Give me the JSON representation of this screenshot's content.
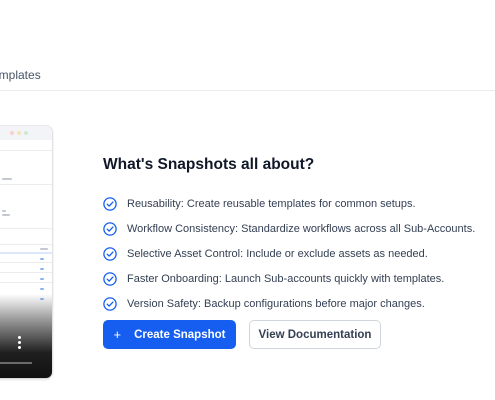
{
  "tabs": {
    "templates_label": "emplates"
  },
  "main": {
    "title": "What's Snapshots all about?",
    "features": [
      "Reusability: Create reusable templates for common setups.",
      "Workflow Consistency: Standardize workflows across all Sub-Accounts.",
      "Selective Asset Control: Include or exclude assets as needed.",
      "Faster Onboarding: Launch Sub-accounts quickly with templates.",
      "Version Safety: Backup configurations before major changes."
    ],
    "create_button": {
      "icon": "+",
      "label": "Create Snapshot"
    },
    "docs_button": {
      "label": "View Documentation"
    }
  },
  "colors": {
    "primary": "#155eef",
    "check_icon": "#155eef",
    "text_heading": "#101828",
    "text_body": "#344054"
  },
  "icons": {
    "feature": "check-circle-icon",
    "create": "plus-icon",
    "preview_menu": "more-vertical-icon"
  }
}
